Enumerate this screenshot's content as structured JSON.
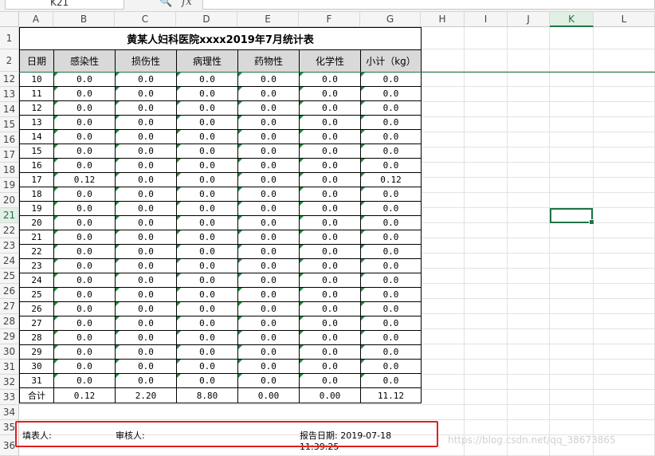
{
  "formula_bar": {
    "name_box": "K21",
    "fx_label": "fx",
    "zoom_icon": "search-icon"
  },
  "columns": [
    "A",
    "B",
    "C",
    "D",
    "E",
    "F",
    "G",
    "H",
    "I",
    "J",
    "K",
    "L"
  ],
  "row_numbers": [
    "1",
    "2",
    "12",
    "13",
    "14",
    "15",
    "16",
    "17",
    "18",
    "19",
    "20",
    "21",
    "22",
    "23",
    "24",
    "25",
    "26",
    "27",
    "28",
    "29",
    "30",
    "31",
    "32",
    "33",
    "34",
    "35",
    "36"
  ],
  "selected": {
    "column": "K",
    "row": "21"
  },
  "report": {
    "title": "黄某人妇科医院xxxx2019年7月统计表",
    "headers": [
      "日期",
      "感染性",
      "损伤性",
      "病理性",
      "药物性",
      "化学性",
      "小计（kg）"
    ],
    "rows": [
      [
        "10",
        "0.0",
        "0.0",
        "0.0",
        "0.0",
        "0.0",
        "0.0"
      ],
      [
        "11",
        "0.0",
        "0.0",
        "0.0",
        "0.0",
        "0.0",
        "0.0"
      ],
      [
        "12",
        "0.0",
        "0.0",
        "0.0",
        "0.0",
        "0.0",
        "0.0"
      ],
      [
        "13",
        "0.0",
        "0.0",
        "0.0",
        "0.0",
        "0.0",
        "0.0"
      ],
      [
        "14",
        "0.0",
        "0.0",
        "0.0",
        "0.0",
        "0.0",
        "0.0"
      ],
      [
        "15",
        "0.0",
        "0.0",
        "0.0",
        "0.0",
        "0.0",
        "0.0"
      ],
      [
        "16",
        "0.0",
        "0.0",
        "0.0",
        "0.0",
        "0.0",
        "0.0"
      ],
      [
        "17",
        "0.12",
        "0.0",
        "0.0",
        "0.0",
        "0.0",
        "0.12"
      ],
      [
        "18",
        "0.0",
        "0.0",
        "0.0",
        "0.0",
        "0.0",
        "0.0"
      ],
      [
        "19",
        "0.0",
        "0.0",
        "0.0",
        "0.0",
        "0.0",
        "0.0"
      ],
      [
        "20",
        "0.0",
        "0.0",
        "0.0",
        "0.0",
        "0.0",
        "0.0"
      ],
      [
        "21",
        "0.0",
        "0.0",
        "0.0",
        "0.0",
        "0.0",
        "0.0"
      ],
      [
        "22",
        "0.0",
        "0.0",
        "0.0",
        "0.0",
        "0.0",
        "0.0"
      ],
      [
        "23",
        "0.0",
        "0.0",
        "0.0",
        "0.0",
        "0.0",
        "0.0"
      ],
      [
        "24",
        "0.0",
        "0.0",
        "0.0",
        "0.0",
        "0.0",
        "0.0"
      ],
      [
        "25",
        "0.0",
        "0.0",
        "0.0",
        "0.0",
        "0.0",
        "0.0"
      ],
      [
        "26",
        "0.0",
        "0.0",
        "0.0",
        "0.0",
        "0.0",
        "0.0"
      ],
      [
        "27",
        "0.0",
        "0.0",
        "0.0",
        "0.0",
        "0.0",
        "0.0"
      ],
      [
        "28",
        "0.0",
        "0.0",
        "0.0",
        "0.0",
        "0.0",
        "0.0"
      ],
      [
        "29",
        "0.0",
        "0.0",
        "0.0",
        "0.0",
        "0.0",
        "0.0"
      ],
      [
        "30",
        "0.0",
        "0.0",
        "0.0",
        "0.0",
        "0.0",
        "0.0"
      ],
      [
        "31",
        "0.0",
        "0.0",
        "0.0",
        "0.0",
        "0.0",
        "0.0"
      ]
    ],
    "total": [
      "合计",
      "0.12",
      "2.20",
      "8.80",
      "0.00",
      "0.00",
      "11.12"
    ],
    "footer": {
      "preparer": "填表人:",
      "reviewer": "审核人:",
      "report_date": "报告日期: 2019-07-18 11:39:25"
    }
  },
  "watermark": "https://blog.csdn.net/qq_38673865",
  "colors": {
    "accent": "#217346",
    "highlight_box": "#e02020",
    "header_fill": "#d9d9d9"
  }
}
